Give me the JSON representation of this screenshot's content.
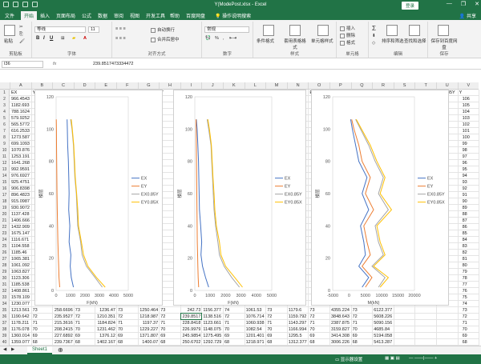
{
  "window": {
    "title": "Y(ModePost.xlsx - Excel",
    "login_label": "登录",
    "controls": [
      "—",
      "❐",
      "✕"
    ]
  },
  "tabs": [
    "文件",
    "开始",
    "插入",
    "页面布局",
    "公式",
    "数据",
    "审阅",
    "视图",
    "开发工具",
    "帮助",
    "百度网盘"
  ],
  "active_tab": "开始",
  "tell_me": "操作说明搜索",
  "share_label": "共享",
  "ribbon": {
    "clipboard": {
      "paste": "粘贴",
      "label": "剪贴板"
    },
    "font": {
      "name": "等线",
      "size": "11",
      "label": "字体",
      "bold": "B",
      "italic": "I",
      "underline": "U"
    },
    "alignment": {
      "wrap": "自动换行",
      "merge": "合并后居中",
      "label": "对齐方式"
    },
    "number": {
      "format": "常规",
      "label": "数字",
      "percent": "%",
      "comma": ","
    },
    "styles": {
      "conditional": "条件格式",
      "table": "套用表格格式",
      "cell": "单元格样式",
      "label": "样式"
    },
    "cells": {
      "insert": "插入",
      "delete": "删除",
      "format": "格式",
      "label": "单元格"
    },
    "editing": {
      "sort": "排序和筛选",
      "find": "查找和选择",
      "label": "编辑"
    },
    "save": {
      "btn": "保存到百度网盘",
      "label": "保存"
    }
  },
  "formula_bar": {
    "name_box": "I36",
    "fx": "fx",
    "value": "239.8517473334472"
  },
  "columns": [
    "A",
    "B",
    "C",
    "D",
    "E",
    "F",
    "G",
    "H",
    "I",
    "J",
    "K",
    "L",
    "M",
    "N",
    "O",
    "P",
    "Q",
    "R",
    "S",
    "T",
    "U",
    "V"
  ],
  "header_row": [
    "EX",
    "Y",
    "EY",
    "Y",
    "EX0.85Y",
    "Y",
    "EY0.85X",
    "Y",
    "EX",
    "Y",
    "EY",
    "Y",
    "EX0.85Y",
    "Y",
    "EY0.85X",
    "Y",
    "EX",
    "Y",
    "EY",
    "Y",
    "EX0.85Y",
    "Y"
  ],
  "col_a_values": [
    "966.4543",
    "1182.693",
    "788.1624",
    "579.9252",
    "565.5772",
    "616.2533",
    "1273.587",
    "699.1093",
    "1070.876",
    "1253.191",
    "1641.268",
    "992.9591",
    "976.6927",
    "925.4751",
    "906.8398",
    "896.4823",
    "915.0987",
    "930.9072",
    "1137.428",
    "1406.666",
    "1432.909",
    "1675.147",
    "1116.671",
    "1104.558",
    "1185.46",
    "1065.381",
    "1061.092",
    "1063.827",
    "1123.306",
    "1185.538",
    "1408.861",
    "1578.109",
    "1230.077",
    "1213.561",
    "1190.642",
    "1178.211",
    "1176.078",
    "1360.014",
    "1359.077"
  ],
  "col_v_values": [
    "106",
    "105",
    "104",
    "103",
    "102",
    "101",
    "100",
    "99",
    "98",
    "97",
    "96",
    "95",
    "94",
    "93",
    "92",
    "91",
    "90",
    "89",
    "88",
    "87",
    "86",
    "85",
    "84",
    "83",
    "82",
    "81",
    "80",
    "79",
    "78",
    "77",
    "76",
    "75",
    "74",
    "73",
    "72",
    "71",
    "70",
    "69",
    "68"
  ],
  "bottom_rows": [
    [
      "73",
      "258.6696",
      "73",
      "1236.47",
      "73",
      "1250.464",
      "73",
      "242.73"
    ],
    [
      "72",
      "235.9527",
      "72",
      "1210.351",
      "72",
      "1218.987",
      "72",
      "239.8517"
    ],
    [
      "71",
      "215.3616",
      "71",
      "1184.824",
      "71",
      "1197.37",
      "71",
      "228.8418"
    ],
    [
      "70",
      "208.2415",
      "70",
      "1231.462",
      "70",
      "1229.227",
      "70",
      "226.9979"
    ],
    [
      "69",
      "227.6892",
      "69",
      "1376.12",
      "69",
      "1371.807",
      "69",
      "245.9854"
    ],
    [
      "68",
      "239.7367",
      "68",
      "1402.167",
      "68",
      "1400.07",
      "68",
      "250.6702"
    ]
  ],
  "bottom_rows_right": [
    [
      "1156.377",
      "74",
      "1061.53",
      "73",
      "1179.6",
      "73",
      "4355.224",
      "73",
      "6122.377"
    ],
    [
      "1138.516",
      "72",
      "1076.714",
      "72",
      "1159.792",
      "72",
      "3848.643",
      "72",
      "5608.226"
    ],
    [
      "1123.661",
      "71",
      "1060.938",
      "71",
      "1143.297",
      "71",
      "2387.875",
      "71",
      "5090.156"
    ],
    [
      "1148.075",
      "70",
      "1082.54",
      "70",
      "1166.994",
      "70",
      "3159.827",
      "70",
      "4685.84"
    ],
    [
      "1275.495",
      "69",
      "1201.401",
      "69",
      "1295.5",
      "69",
      "3414.308",
      "69",
      "5194.058"
    ],
    [
      "1292.729",
      "68",
      "1218.971",
      "68",
      "1312.377",
      "68",
      "3006.226",
      "68",
      "5413.287"
    ]
  ],
  "sheet_tab": "Sheet1",
  "status_text": "显示器设置",
  "colors": {
    "EX": "#4472C4",
    "EY": "#ED7D31",
    "EX085Y": "#A5A5A5",
    "EY085X": "#FFC000",
    "accent": "#217346"
  },
  "chart_data": [
    {
      "type": "line",
      "title": "",
      "xlabel": "F(kN)",
      "ylabel": "楼层",
      "xlim": [
        0,
        5000
      ],
      "ylim": [
        0,
        120
      ],
      "xticks": [
        "0",
        "1000",
        "2000",
        "3000",
        "4000",
        "5000"
      ],
      "yticks": [
        "0",
        "20",
        "40",
        "60",
        "80",
        "100",
        "120"
      ],
      "legend": "right",
      "series": [
        {
          "name": "EX",
          "y": [
            2,
            8,
            15,
            22,
            30,
            40,
            50,
            60,
            70,
            80,
            90,
            100,
            106
          ],
          "x": [
            1200,
            1050,
            980,
            1020,
            900,
            950,
            870,
            900,
            880,
            850,
            800,
            780,
            760
          ]
        },
        {
          "name": "EY",
          "y": [
            2,
            8,
            15,
            22,
            30,
            40,
            50,
            60,
            70,
            80,
            90,
            100,
            106
          ],
          "x": [
            250,
            200,
            180,
            150,
            120,
            100,
            80,
            60,
            50,
            40,
            30,
            20,
            10
          ]
        },
        {
          "name": "EX0.85Y",
          "y": [
            2,
            8,
            15,
            22,
            30,
            40,
            50,
            60,
            70,
            80,
            90,
            100,
            106
          ],
          "x": [
            3200,
            2700,
            2100,
            1800,
            1700,
            1500,
            1450,
            1400,
            1300,
            1250,
            1200,
            1100,
            1000
          ]
        },
        {
          "name": "EY0.85X",
          "y": [
            2,
            8,
            15,
            22,
            30,
            40,
            50,
            60,
            70,
            80,
            90,
            100,
            106
          ],
          "x": [
            3400,
            2800,
            2200,
            1900,
            1750,
            1550,
            1500,
            1420,
            1330,
            1280,
            1220,
            1120,
            1050
          ]
        }
      ]
    },
    {
      "type": "line",
      "title": "",
      "xlabel": "F(kN)",
      "ylabel": "楼层",
      "xlim": [
        0,
        5000
      ],
      "ylim": [
        0,
        120
      ],
      "xticks": [
        "0",
        "1000",
        "2000",
        "3000",
        "4000",
        "5000"
      ],
      "yticks": [
        "0",
        "20",
        "40",
        "60",
        "80",
        "100",
        "120"
      ],
      "legend": "right",
      "series": [
        {
          "name": "EX",
          "y": [
            2,
            8,
            15,
            22,
            30,
            40,
            50,
            60,
            70,
            80,
            90,
            100,
            106
          ],
          "x": [
            900,
            700,
            500,
            400,
            450,
            380,
            300,
            280,
            260,
            240,
            200,
            150,
            100
          ]
        },
        {
          "name": "EY",
          "y": [
            2,
            8,
            15,
            22,
            30,
            40,
            50,
            60,
            70,
            80,
            90,
            100,
            106
          ],
          "x": [
            250,
            220,
            200,
            180,
            160,
            150,
            140,
            130,
            120,
            110,
            100,
            90,
            80
          ]
        },
        {
          "name": "EX0.85Y",
          "y": [
            2,
            8,
            15,
            22,
            30,
            40,
            50,
            60,
            70,
            80,
            90,
            100,
            106
          ],
          "x": [
            2900,
            2400,
            1900,
            1600,
            1500,
            1350,
            1250,
            1200,
            1150,
            1100,
            1050,
            900,
            800
          ]
        },
        {
          "name": "EY0.85X",
          "y": [
            2,
            8,
            15,
            22,
            30,
            40,
            50,
            60,
            70,
            80,
            90,
            100,
            106
          ],
          "x": [
            3100,
            2600,
            2000,
            1700,
            1600,
            1400,
            1300,
            1250,
            1180,
            1130,
            1080,
            950,
            850
          ]
        }
      ]
    },
    {
      "type": "line",
      "title": "",
      "xlabel": "M(kN)",
      "ylabel": "楼层",
      "xlim": [
        -5000,
        20000
      ],
      "ylim": [
        0,
        120
      ],
      "xticks": [
        "-5000",
        "0",
        "5000",
        "10000",
        "15000",
        "20000"
      ],
      "yticks": [
        "0",
        "20",
        "40",
        "60",
        "80",
        "100",
        "120"
      ],
      "legend": "right",
      "series": [
        {
          "name": "EX",
          "y": [
            2,
            8,
            15,
            22,
            30,
            40,
            50,
            60,
            70,
            80,
            90,
            100,
            106
          ],
          "x": [
            4000,
            6000,
            3000,
            5000,
            4500,
            3500,
            6000,
            4000,
            5500,
            3000,
            2000,
            1000,
            500
          ]
        },
        {
          "name": "EY",
          "y": [
            2,
            8,
            15,
            22,
            30,
            40,
            50,
            60,
            70,
            80,
            90,
            100,
            106
          ],
          "x": [
            5000,
            7000,
            4000,
            6500,
            5500,
            4500,
            7500,
            5000,
            6500,
            4000,
            3000,
            1500,
            800
          ]
        },
        {
          "name": "EX0.85Y",
          "y": [
            2,
            8,
            15,
            22,
            30,
            40,
            50,
            60,
            70,
            80,
            90,
            100,
            106
          ],
          "x": [
            9000,
            11000,
            7000,
            10500,
            9000,
            8000,
            12000,
            9000,
            10500,
            8000,
            6000,
            3500,
            2000
          ]
        },
        {
          "name": "EY0.85X",
          "y": [
            2,
            8,
            15,
            22,
            30,
            40,
            50,
            60,
            70,
            80,
            90,
            100,
            106
          ],
          "x": [
            9500,
            12000,
            7500,
            11000,
            9500,
            8500,
            13000,
            9500,
            11000,
            8500,
            6500,
            3800,
            2200
          ]
        }
      ]
    }
  ]
}
